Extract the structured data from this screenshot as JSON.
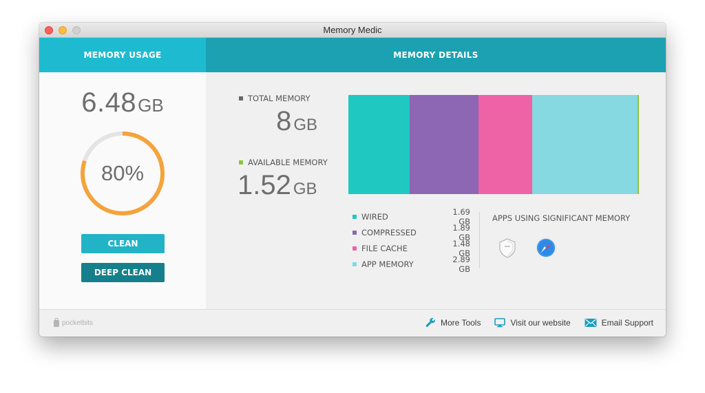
{
  "window": {
    "title": "Memory Medic"
  },
  "header": {
    "left_title": "MEMORY USAGE",
    "right_title": "MEMORY DETAILS"
  },
  "usage": {
    "used_value": "6.48",
    "used_unit": "GB",
    "percent": 80,
    "percent_label": "80%",
    "clean_label": "CLEAN",
    "deep_clean_label": "DEEP CLEAN"
  },
  "details": {
    "total_label": "TOTAL MEMORY",
    "total_value": "8",
    "total_unit": "GB",
    "available_label": "AVAILABLE MEMORY",
    "available_value": "1.52",
    "available_unit": "GB",
    "breakdown": [
      {
        "name": "WIRED",
        "value": "1.69 GB",
        "gb": 1.69,
        "color": "#1fc8c1"
      },
      {
        "name": "COMPRESSED",
        "value": "1.89 GB",
        "gb": 1.89,
        "color": "#8d67b3"
      },
      {
        "name": "FILE CACHE",
        "value": "1.48 GB",
        "gb": 1.48,
        "color": "#ee62a6"
      },
      {
        "name": "APP MEMORY",
        "value": "2.89 GB",
        "gb": 2.89,
        "color": "#86d8e1"
      },
      {
        "name": "",
        "value": "",
        "gb": 0.04,
        "color": "#8cc63e"
      }
    ],
    "apps_title": "APPS USING SIGNIFICANT MEMORY",
    "apps": [
      {
        "name": "shield-app-icon"
      },
      {
        "name": "safari-icon"
      }
    ]
  },
  "colors": {
    "gauge": "#f5a33b",
    "gauge_track": "#e4e4e4",
    "total_marker": "#666666",
    "available_marker": "#8cc63e"
  },
  "footer": {
    "brand": "pocketbits",
    "more_tools": "More Tools",
    "visit_website": "Visit our website",
    "email_support": "Email Support"
  }
}
